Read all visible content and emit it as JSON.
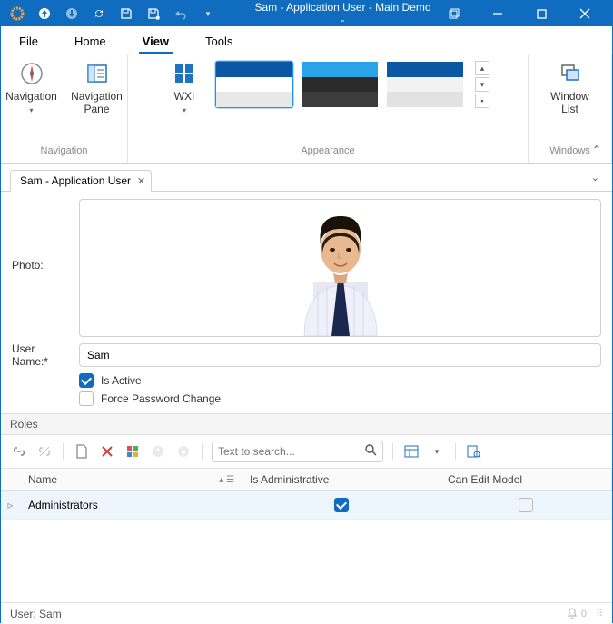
{
  "title": "Sam - Application User - Main Demo -",
  "menus": {
    "file": "File",
    "home": "Home",
    "view": "View",
    "tools": "Tools",
    "active": "view"
  },
  "ribbon": {
    "navigation": {
      "label": "Navigation",
      "nav_btn": "Navigation",
      "pane_btn": "Navigation\nPane"
    },
    "appearance": {
      "label": "Appearance",
      "wxi": "WXI"
    },
    "windows": {
      "label": "Windows",
      "window_list": "Window\nList"
    }
  },
  "doc_tab": {
    "title": "Sam - Application User"
  },
  "form": {
    "photo_label": "Photo:",
    "username_label": "User Name:",
    "username_required": "*",
    "username_value": "Sam",
    "is_active_label": "Is Active",
    "is_active": true,
    "force_pwd_label": "Force Password Change",
    "force_pwd": false
  },
  "roles": {
    "header": "Roles",
    "search_placeholder": "Text to search...",
    "columns": {
      "name": "Name",
      "admin": "Is Administrative",
      "model": "Can Edit Model"
    },
    "rows": [
      {
        "name": "Administrators",
        "is_admin": true,
        "can_edit_model": false
      }
    ]
  },
  "status": {
    "user_label": "User: ",
    "user": "Sam",
    "notif_count": "0"
  }
}
